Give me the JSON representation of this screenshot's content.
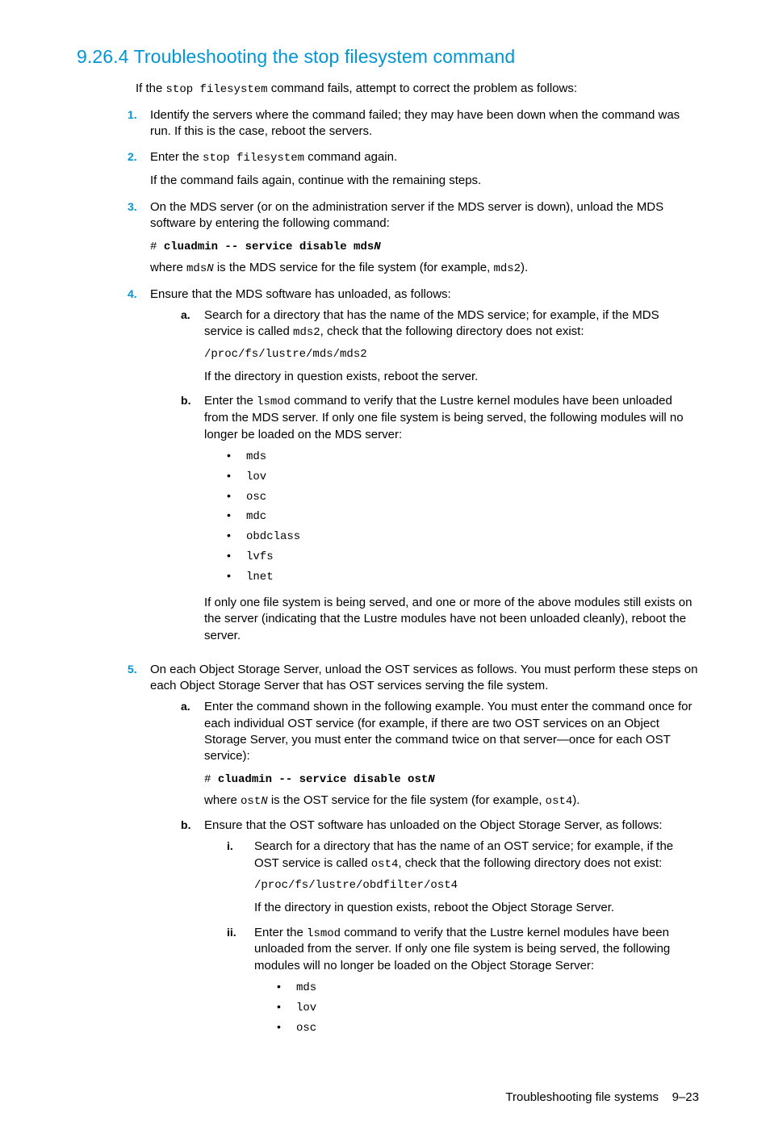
{
  "heading": "9.26.4   Troubleshooting the stop filesystem command",
  "intro_pre": "If the ",
  "intro_cmd": "stop filesystem",
  "intro_post": " command fails, attempt to correct the problem as follows:",
  "s1": "Identify the servers where the command failed; they may have been down when the command was run. If this is the case, reboot the servers.",
  "s2_pre": "Enter the ",
  "s2_cmd": "stop filesystem",
  "s2_post": " command again.",
  "s2_b": "If the command fails again, continue with the remaining steps.",
  "s3_a": "On the MDS server (or on the administration server if the MDS server is down), unload the MDS software by entering the following command:",
  "s3_hash": "# ",
  "s3_cmd": "cluadmin -- service disable mds",
  "s3_cmd_n": "N",
  "s3_w_pre": "where ",
  "s3_w_mdsn": "mds",
  "s3_w_n": "N",
  "s3_w_mid": " is the MDS service for the file system (for example, ",
  "s3_w_ex": "mds2",
  "s3_w_post": ").",
  "s4": "Ensure that the MDS software has unloaded, as follows:",
  "s4a_pre": "Search for a directory that has the name of the MDS service; for example, if the MDS service is called ",
  "s4a_ex": "mds2",
  "s4a_post": ", check that the following directory does not exist:",
  "s4a_path": "/proc/fs/lustre/mds/mds2",
  "s4a_tail": "If the directory in question exists, reboot the server.",
  "s4b_pre": "Enter the ",
  "s4b_cmd": "lsmod",
  "s4b_post": " command to verify that the Lustre kernel modules have been unloaded from the MDS server. If only one file system is being served, the following modules will no longer be loaded on the MDS server:",
  "mods": [
    "mds",
    "lov",
    "osc",
    "mdc",
    "obdclass",
    "lvfs",
    "lnet"
  ],
  "s4b_tail": "If only one file system is being served, and one or more of the above modules still exists on the server (indicating that the Lustre modules have not been unloaded cleanly), reboot the server.",
  "s5": "On each Object Storage Server, unload the OST services as follows. You must perform these steps on each Object Storage Server that has OST services serving the file system.",
  "s5a": "Enter the command shown in the following example. You must enter the command once for each individual OST service (for example, if there are two OST services on an Object Storage Server, you must enter the command twice on that server—once for each OST service):",
  "s5a_hash": "# ",
  "s5a_cmd": "cluadmin -- service disable ost",
  "s5a_cmd_n": "N",
  "s5a_w_pre": "where ",
  "s5a_w_ostn": "ost",
  "s5a_w_n": "N",
  "s5a_w_mid": " is the OST service for the file system (for example, ",
  "s5a_w_ex": "ost4",
  "s5a_w_post": ").",
  "s5b": "Ensure that the OST software has unloaded on the Object Storage Server, as follows:",
  "s5bi_pre": "Search for a directory that has the name of an OST service; for example, if the OST service is called ",
  "s5bi_ex": "ost4",
  "s5bi_post": ", check that the following directory does not exist:",
  "s5bi_path": "/proc/fs/lustre/obdfilter/ost4",
  "s5bi_tail": "If the directory in question exists, reboot the Object Storage Server.",
  "s5bii_pre": "Enter the ",
  "s5bii_cmd": "lsmod",
  "s5bii_post": " command to verify that the Lustre kernel modules have been unloaded from the server. If only one file system is being served, the following modules will no longer be loaded on the Object Storage Server:",
  "mods2": [
    "mds",
    "lov",
    "osc"
  ],
  "footer_text": "Troubleshooting file systems",
  "footer_page": "9–23"
}
